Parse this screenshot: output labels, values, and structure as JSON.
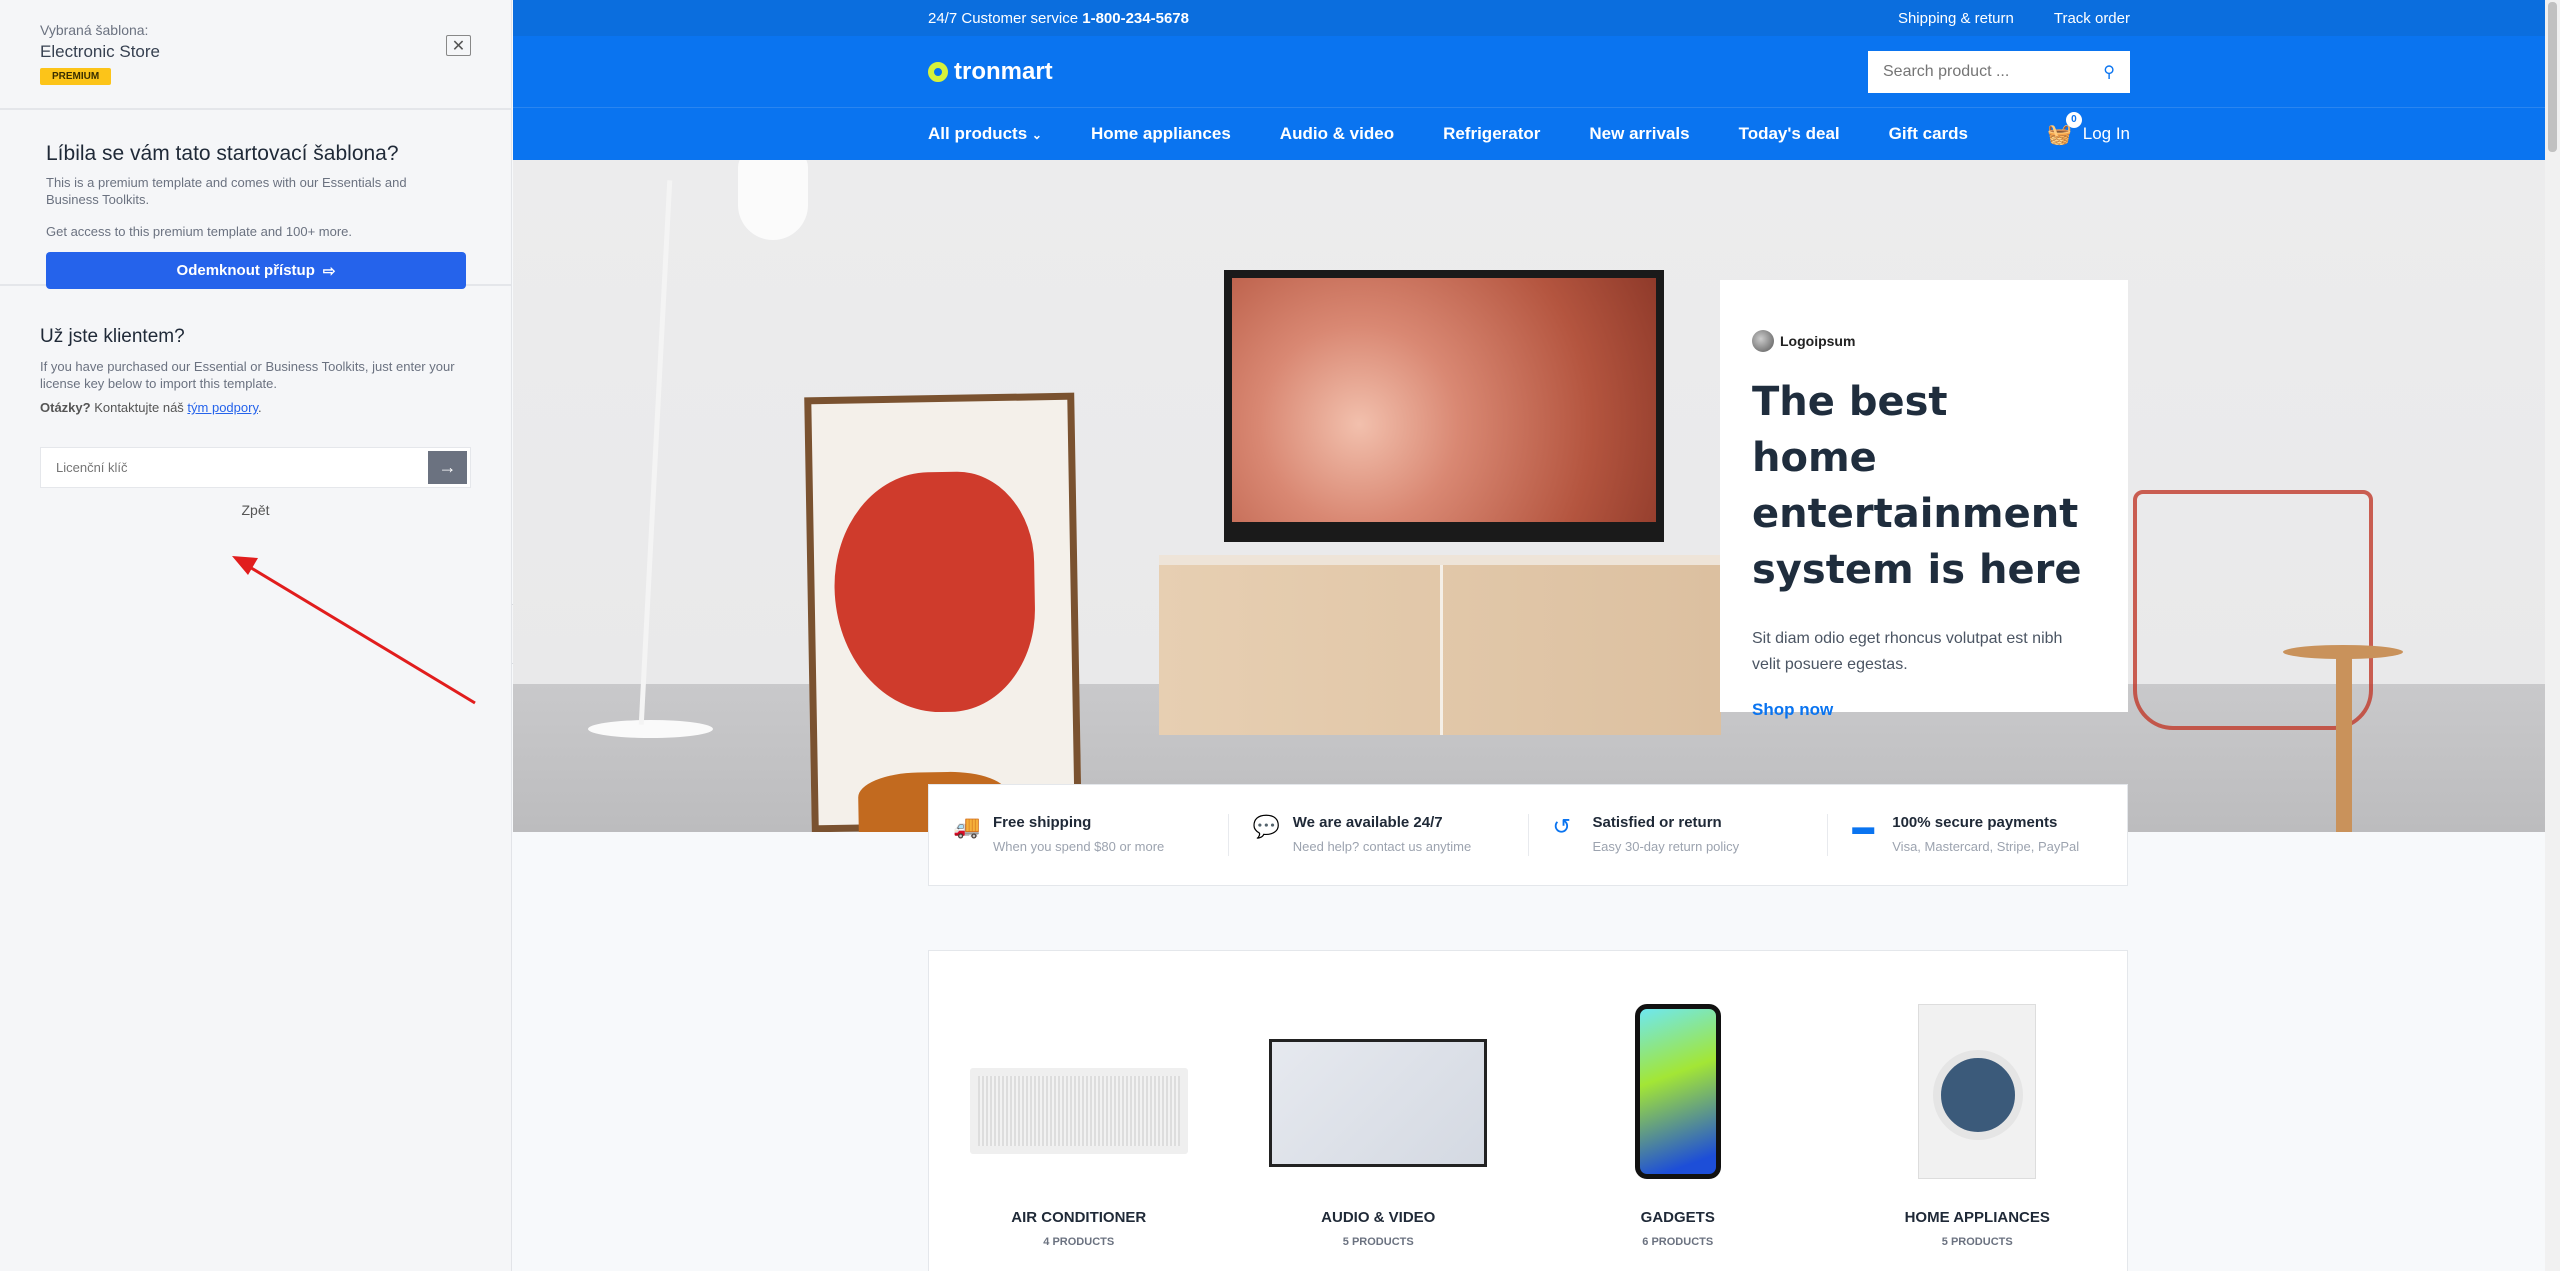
{
  "panel": {
    "selected_label": "Vybraná šablona:",
    "template_name": "Electronic Store",
    "badge": "PREMIUM",
    "promo_title": "Líbila se vám tato startovací šablona?",
    "promo_text": "This is a premium template and comes with our Essentials and Business Toolkits.",
    "promo_text2": "Get access to this premium template and 100+ more.",
    "unlock_button": "Odemknout přístup",
    "client_title": "Už jste klientem?",
    "client_text": "If you have purchased our Essential or Business Toolkits, just enter your license key below to import this template.",
    "questions_bold": "Otázky?",
    "questions_text": " Kontaktujte náš ",
    "support_link": "tým podpory",
    "period": ".",
    "license_placeholder": "Licenční klíč",
    "back_link": "Zpět"
  },
  "site": {
    "topbar": {
      "service_label": "24/7 Customer service ",
      "phone": "1-800-234-5678",
      "links": [
        "Shipping & return",
        "Track order"
      ]
    },
    "logo": "tronmart",
    "search_placeholder": "Search product ...",
    "nav": [
      "All products",
      "Home appliances",
      "Audio & video",
      "Refrigerator",
      "New arrivals",
      "Today's deal",
      "Gift cards"
    ],
    "cart_count": "0",
    "login": "Log In",
    "hero": {
      "brand": "Logoipsum",
      "title": "The best home entertainment system is here",
      "text": "Sit diam odio eget rhoncus volutpat est nibh velit posuere egestas.",
      "cta": "Shop now"
    },
    "features": [
      {
        "icon": "truck-icon",
        "title": "Free shipping",
        "sub": "When you spend $80 or more"
      },
      {
        "icon": "chat-icon",
        "title": "We are available 24/7",
        "sub": "Need help? contact us anytime"
      },
      {
        "icon": "return-icon",
        "title": "Satisfied or return",
        "sub": "Easy 30-day return policy"
      },
      {
        "icon": "credit-card-icon",
        "title": "100% secure payments",
        "sub": "Visa, Mastercard, Stripe, PayPal"
      }
    ],
    "categories": [
      {
        "name": "AIR CONDITIONER",
        "count": "4 PRODUCTS"
      },
      {
        "name": "AUDIO & VIDEO",
        "count": "5 PRODUCTS"
      },
      {
        "name": "GADGETS",
        "count": "6 PRODUCTS"
      },
      {
        "name": "HOME APPLIANCES",
        "count": "5 PRODUCTS"
      }
    ]
  },
  "colors": {
    "primary": "#0a74f0",
    "topbar": "#0b6ede",
    "unlock": "#2563eb",
    "badge": "#fcc419",
    "annotation_arrow": "#e11d1d"
  }
}
